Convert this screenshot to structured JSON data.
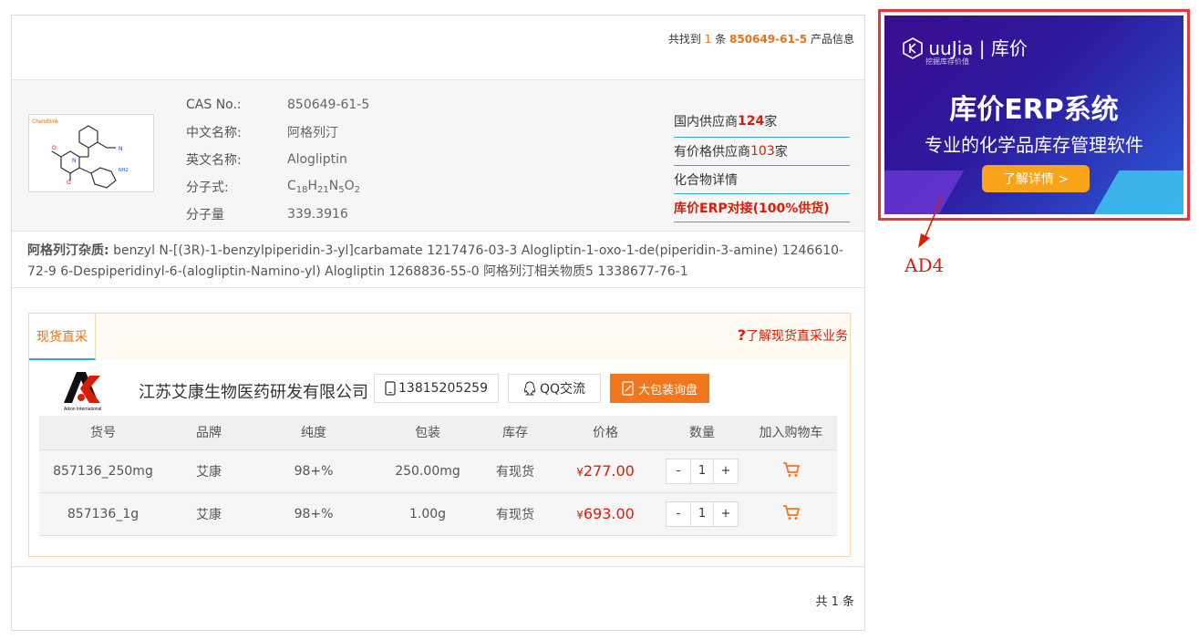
{
  "result": {
    "prefix": "共找到",
    "count": "1",
    "mid": "条",
    "cas": "850649-61-5",
    "suffix": "产品信息"
  },
  "compound": {
    "fields": [
      {
        "label": "CAS No.:",
        "value": "850649-61-5"
      },
      {
        "label": "中文名称:",
        "value": "阿格列汀"
      },
      {
        "label": "英文名称:",
        "value": "Alogliptin"
      },
      {
        "label": "分子式:",
        "value": "C18H21N5O2"
      },
      {
        "label": "分子量",
        "value": "339.3916"
      }
    ],
    "formula_parts": [
      "C",
      "18",
      "H",
      "21",
      "N",
      "5",
      "O",
      "2"
    ],
    "structure_logo": "ChemBlink",
    "nh2_label": "NH2"
  },
  "side_links": {
    "domestic_prefix": "国内供应商",
    "domestic_count": "124",
    "domestic_suffix": "家",
    "priced_prefix": "有价格供应商",
    "priced_count": "103",
    "priced_suffix": "家",
    "details": "化合物详情",
    "erp": "库价ERP对接(100%供货)"
  },
  "impurity": {
    "title": "阿格列汀杂质:",
    "text": "benzyl N-[(3R)-1-benzylpiperidin-3-yl]carbamate  1217476-03-3   Alogliptin-1-oxo-1-de(piperidin-3-amine)  1246610-72-9   6-Despiperidinyl-6-(alogliptin-Namino-yl) Alogliptin  1268836-55-0   阿格列汀相关物质5  1338677-76-1"
  },
  "spot": {
    "tab": "现货直采",
    "help_icon": "?",
    "help_text": "了解现货直采业务",
    "company_name": "江苏艾康生物医药研发有限公司",
    "company_logo_text": "Aikon International",
    "phone": "13815205259",
    "qq": "QQ交流",
    "bulk": "大包装询盘",
    "columns": [
      "货号",
      "品牌",
      "纯度",
      "包装",
      "库存",
      "价格",
      "数量",
      "加入购物车"
    ],
    "rows": [
      {
        "sku": "857136_250mg",
        "brand": "艾康",
        "purity": "98+%",
        "pack": "250.00mg",
        "stock": "有现货",
        "currency": "¥",
        "price": "277.00",
        "qty": "1"
      },
      {
        "sku": "857136_1g",
        "brand": "艾康",
        "purity": "98+%",
        "pack": "1.00g",
        "stock": "有现货",
        "currency": "¥",
        "price": "693.00",
        "qty": "1"
      }
    ],
    "minus": "-",
    "plus": "+"
  },
  "footer": {
    "total": "共 1 条"
  },
  "ad": {
    "brand": "uuJia | 库价",
    "brand_sub": "挖掘库存价值",
    "title": "库价ERP系统",
    "subtitle": "专业的化学品库存管理软件",
    "button": "了解详情 >",
    "label": "AD4",
    "colors": {
      "frame": "#e8363a",
      "button": "#f7a41b"
    }
  },
  "colors": {
    "accent": "#e4731f",
    "price": "#d81e06",
    "link_line": "#3ba9cf"
  }
}
